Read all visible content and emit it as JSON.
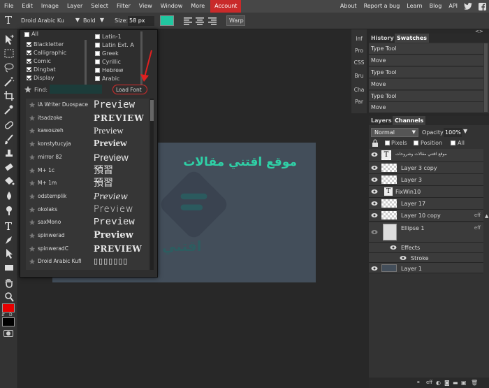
{
  "menu": {
    "items": [
      "File",
      "Edit",
      "Image",
      "Layer",
      "Select",
      "Filter",
      "View",
      "Window",
      "More"
    ],
    "account": "Account",
    "right_links": [
      "About",
      "Report a bug",
      "Learn",
      "Blog",
      "API"
    ]
  },
  "options": {
    "tool_icon": "T",
    "font_name": "Droid Arabic Ku",
    "font_weight": "Bold",
    "size_label": "Size:",
    "size_value": "58 px",
    "color_swatch": "#21c7a0",
    "warp_label": "Warp"
  },
  "font_panel": {
    "all_label": "All",
    "scripts_left": [
      "Blackletter",
      "Calligraphic",
      "Comic",
      "Dingbat",
      "Display"
    ],
    "scripts_right": [
      "Latin-1",
      "Latin Ext. A",
      "Greek",
      "Cyrillic",
      "Hebrew",
      "Arabic"
    ],
    "find_label": "Find:",
    "load_font_label": "Load Font",
    "fonts": [
      {
        "name": "iA Writer Duospace",
        "preview": "Preview"
      },
      {
        "name": "itsadzoke",
        "preview": "PREVIEW"
      },
      {
        "name": "kawoszeh",
        "preview": "Preview"
      },
      {
        "name": "konstytucyja",
        "preview": "Preview"
      },
      {
        "name": "mirror 82",
        "preview": "Preview"
      },
      {
        "name": "M+ 1c",
        "preview": "預習"
      },
      {
        "name": "M+ 1m",
        "preview": "預習"
      },
      {
        "name": "odstemplik",
        "preview": "Preview"
      },
      {
        "name": "okolaks",
        "preview": "Preview"
      },
      {
        "name": "saxMono",
        "preview": "Preview"
      },
      {
        "name": "spinwerad",
        "preview": "Preview"
      },
      {
        "name": "spinweradC",
        "preview": "PREVIEW"
      },
      {
        "name": "Droid Arabic Kufi",
        "preview": "▯▯▯▯▯▯▯"
      }
    ]
  },
  "canvas": {
    "text": "موقع اقتني مقالات",
    "watermark_text": "اقتني"
  },
  "side_buttons": [
    "Inf",
    "Pro",
    "CSS",
    "Bru",
    "Cha",
    "Par"
  ],
  "history_panel": {
    "tabs": [
      "History",
      "Swatches"
    ],
    "rows": [
      "Type Tool",
      "Move",
      "Type Tool",
      "Move",
      "Type Tool",
      "Move"
    ]
  },
  "layers_panel": {
    "tabs": [
      "Layers",
      "Channels"
    ],
    "blend_mode": "Normal",
    "opacity_label": "Opacity:",
    "opacity_value": "100%",
    "lock_label_pixels": "Pixels",
    "lock_label_position": "Position",
    "lock_label_all": "All",
    "layers": [
      {
        "name": "موقع اقتني مقالات وشروحات",
        "type": "text",
        "fx": ""
      },
      {
        "name": "Layer 3 copy",
        "type": "image",
        "fx": ""
      },
      {
        "name": "Layer 3",
        "type": "image",
        "fx": ""
      },
      {
        "name": "FixWin10",
        "type": "text",
        "fx": ""
      },
      {
        "name": "Layer 17",
        "type": "image",
        "fx": ""
      },
      {
        "name": "Layer 10 copy",
        "type": "image",
        "fx": "eff"
      },
      {
        "name": "Ellipse 1",
        "type": "shape",
        "fx": "eff"
      },
      {
        "name": "Effects",
        "type": "effects",
        "fx": ""
      },
      {
        "name": "Stroke",
        "type": "effect",
        "fx": ""
      },
      {
        "name": "Layer 1",
        "type": "fill",
        "fx": ""
      }
    ],
    "footer_eff": "eff"
  },
  "colors": {
    "accent_red": "#c92a2a",
    "teal": "#21c7a0",
    "foreground": "#e60000",
    "background": "#000000"
  }
}
